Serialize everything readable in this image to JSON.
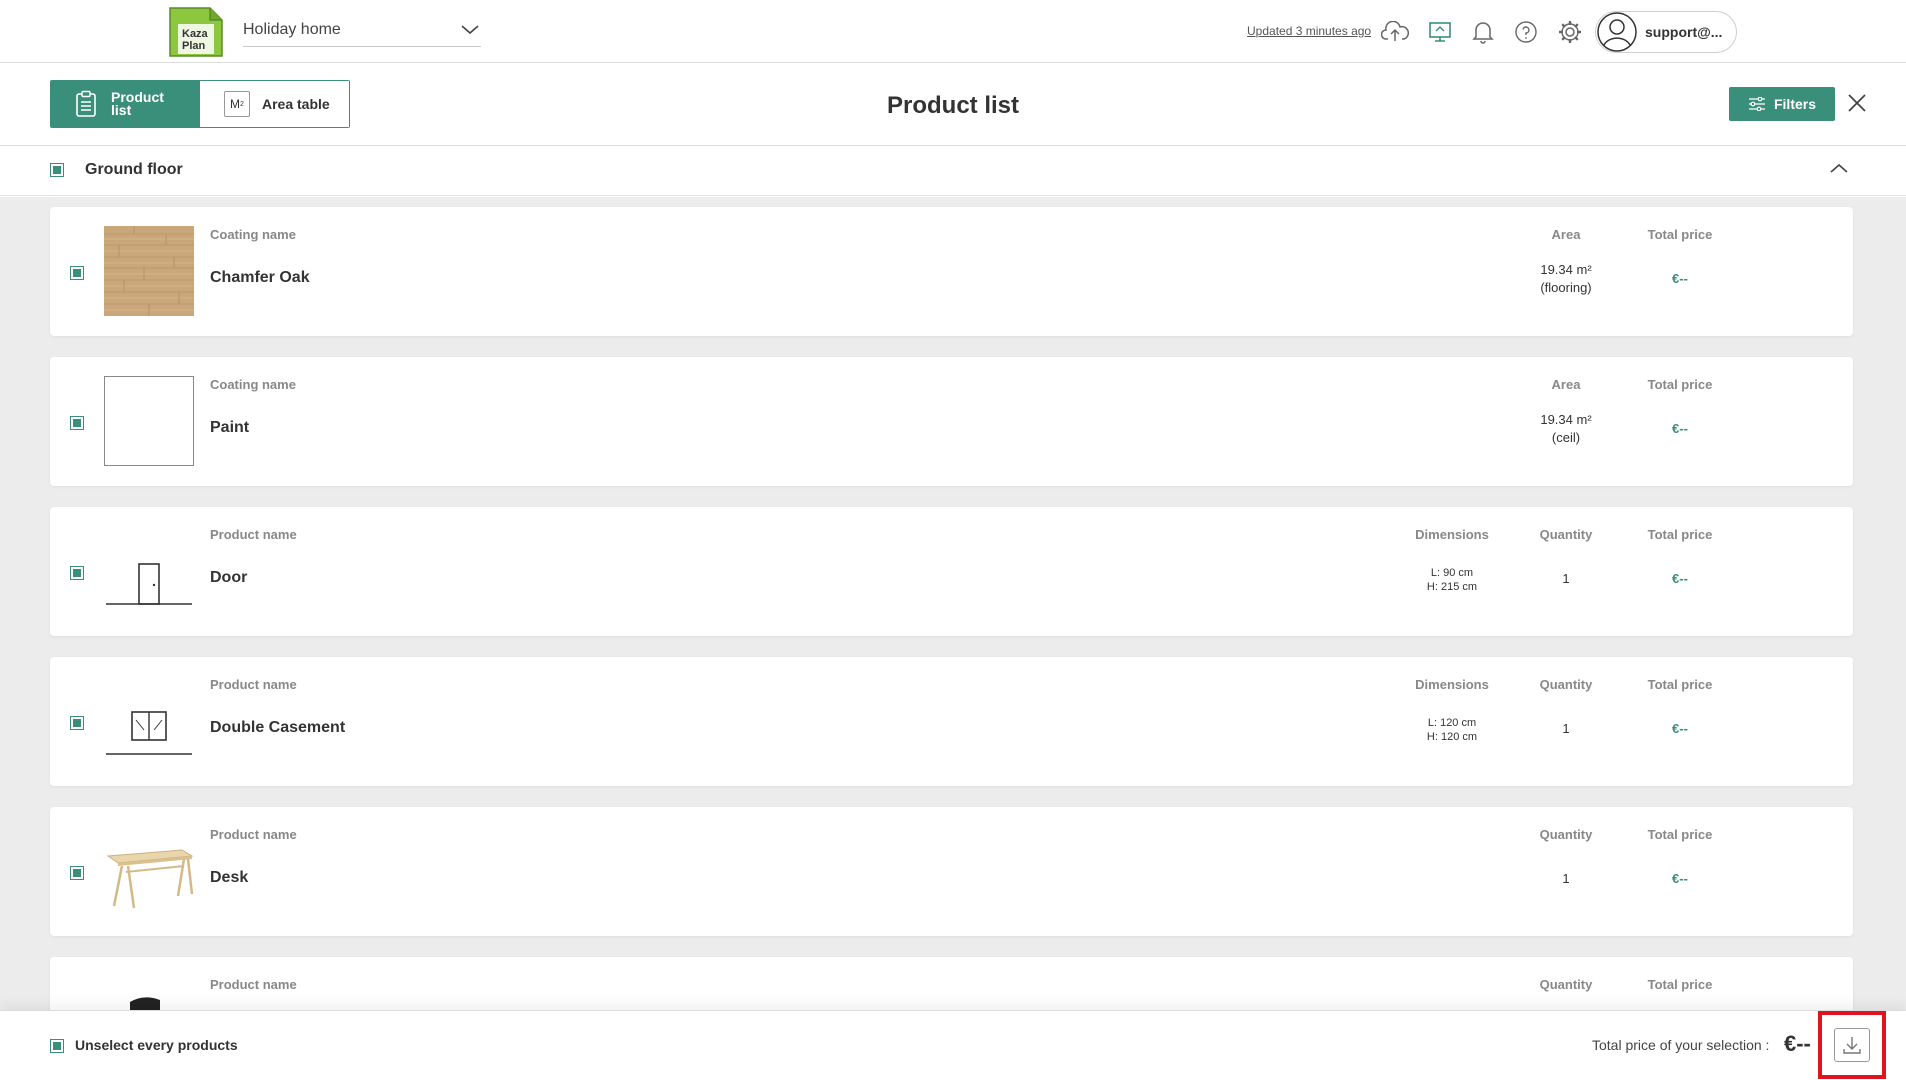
{
  "header": {
    "logo_text": [
      "Kaza",
      "Plan"
    ],
    "project_name": "Holiday home",
    "updated_text": "Updated 3 minutes ago",
    "user_name": "support@..."
  },
  "subheader": {
    "tabs": [
      {
        "label": "Product list",
        "active": true
      },
      {
        "label": "Area table",
        "active": false,
        "icon_text": "M"
      }
    ],
    "title": "Product list",
    "filters_label": "Filters"
  },
  "section": {
    "label": "Ground floor",
    "checked": true
  },
  "items": [
    {
      "header": "Coating name",
      "name": "Chamfer Oak",
      "thumb": "wood-texture",
      "area_header": "Area",
      "area": "19.34 m²",
      "area_note": "(flooring)",
      "price_header": "Total price",
      "price": "€--"
    },
    {
      "header": "Coating name",
      "name": "Paint",
      "thumb": "white-swatch",
      "area_header": "Area",
      "area": "19.34 m²",
      "area_note": "(ceil)",
      "price_header": "Total price",
      "price": "€--"
    },
    {
      "header": "Product name",
      "name": "Door",
      "thumb": "door-icon",
      "dim_header": "Dimensions",
      "dim_l": "L: 90 cm",
      "dim_h": "H: 215 cm",
      "qty_header": "Quantity",
      "qty": "1",
      "price_header": "Total price",
      "price": "€--"
    },
    {
      "header": "Product name",
      "name": "Double Casement",
      "thumb": "window-icon",
      "dim_header": "Dimensions",
      "dim_l": "L: 120 cm",
      "dim_h": "H: 120 cm",
      "qty_header": "Quantity",
      "qty": "1",
      "price_header": "Total price",
      "price": "€--"
    },
    {
      "header": "Product name",
      "name": "Desk",
      "thumb": "desk-image",
      "qty_header": "Quantity",
      "qty": "1",
      "price_header": "Total price",
      "price": "€--"
    },
    {
      "header": "Product name",
      "name": "",
      "thumb": "chair-image",
      "qty_header": "Quantity",
      "price_header": "Total price"
    }
  ],
  "footer": {
    "unselect_label": "Unselect every products",
    "total_label": "Total price of your selection :",
    "total_value": "€--"
  },
  "colors": {
    "accent": "#3a8f7a",
    "highlight": "#e0141e",
    "logo_green": "#8dc63f"
  }
}
